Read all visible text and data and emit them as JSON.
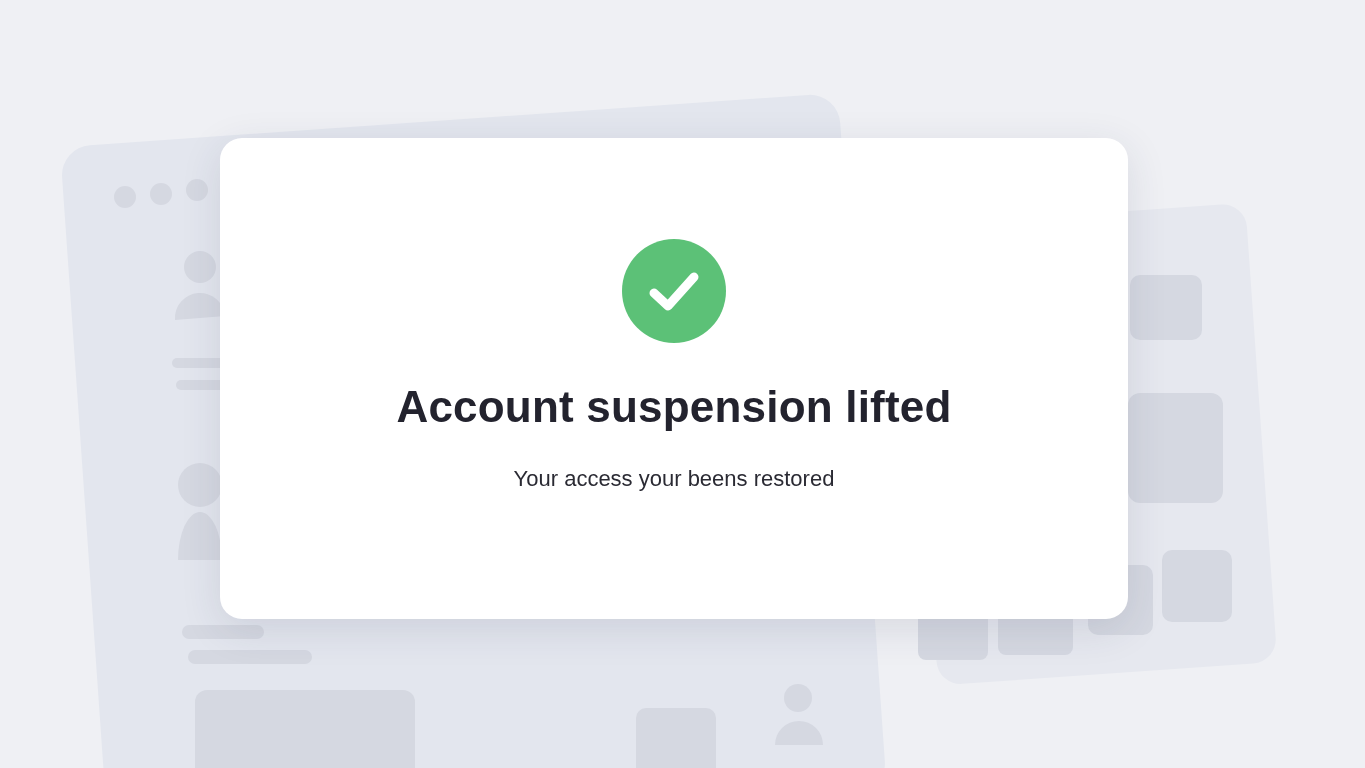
{
  "dialog": {
    "title": "Account suspension lifted",
    "message": "Your access your beens restored"
  }
}
